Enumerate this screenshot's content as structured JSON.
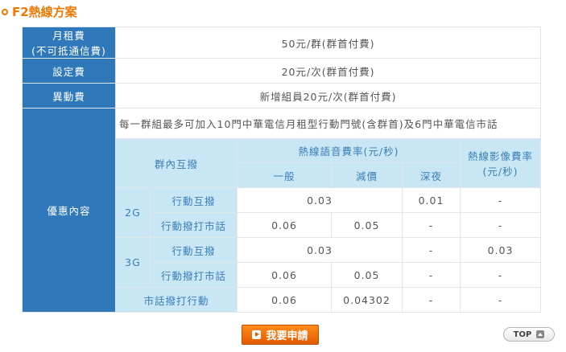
{
  "title": "F2熱線方案",
  "rows": {
    "monthly_fee": {
      "label": "月租費",
      "sublabel": "(不可抵通信費)",
      "value": "50元/群(群首付費)"
    },
    "setup_fee": {
      "label": "設定費",
      "value": "20元/次(群首付費)"
    },
    "change_fee": {
      "label": "異動費",
      "value": "新增組員20元/次(群首付費)"
    },
    "offer": {
      "label": "優惠內容",
      "description": "每一群組最多可加入10門中華電信月租型行動門號(含群首)及6門中華電信市話",
      "table": {
        "header_internal": "群內互撥",
        "header_voice": "熱線語音費率(元/秒)",
        "header_video": "熱線影像費率(元/秒)",
        "col_normal": "一般",
        "col_discount": "減價",
        "col_night": "深夜",
        "g2": {
          "label": "2G",
          "mobile_label": "行動互撥",
          "mobile_rate": "0.03",
          "mobile_night": "0.01",
          "mobile_video": "-",
          "landline_label": "行動撥打市話",
          "landline_normal": "0.06",
          "landline_discount": "0.05",
          "landline_night": "-",
          "landline_video": "-"
        },
        "g3": {
          "label": "3G",
          "mobile_label": "行動互撥",
          "mobile_rate": "0.03",
          "mobile_night": "-",
          "mobile_video": "0.03",
          "landline_label": "行動撥打市話",
          "landline_normal": "0.06",
          "landline_discount": "0.05",
          "landline_night": "-",
          "landline_video": "-"
        },
        "landline_to_mobile": {
          "label": "市話撥打行動",
          "normal": "0.06",
          "discount": "0.04302",
          "night": "-",
          "video": "-"
        }
      }
    }
  },
  "apply_button": "我要申請",
  "top_button": "TOP",
  "colors": {
    "accent": "#f07800",
    "header_blue": "#2f78ba",
    "light_blue": "#c8e6f3"
  }
}
